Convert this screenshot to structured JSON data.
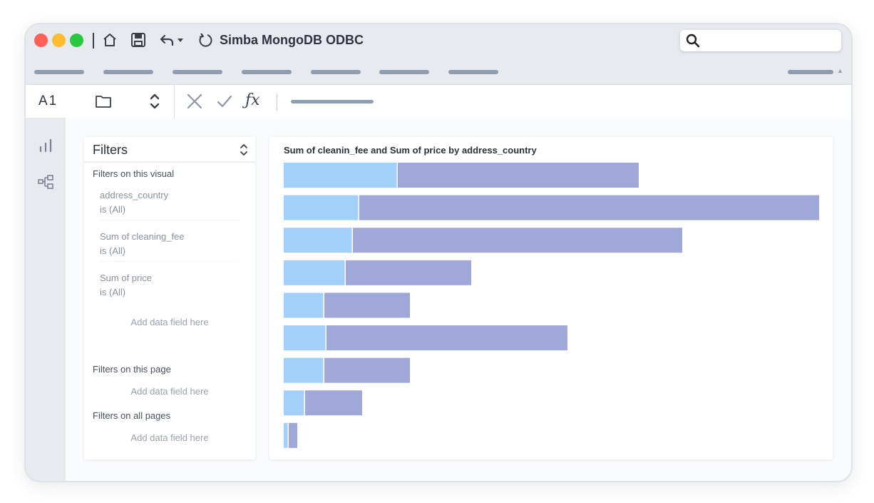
{
  "window": {
    "title": "Simba MongoDB ODBC"
  },
  "toolbar": {
    "icons": [
      "home-icon",
      "save-icon",
      "undo-icon",
      "dropdown-icon",
      "refresh-icon",
      "search-icon"
    ],
    "search_placeholder": ""
  },
  "formula_bar": {
    "cell_ref": "A1",
    "fx_label": "ƒx"
  },
  "sidenav": {
    "icons": [
      "chart-icon",
      "diagram-icon"
    ]
  },
  "filters": {
    "title": "Filters",
    "on_visual_label": "Filters on this visual",
    "items": [
      {
        "name": "address_country",
        "value": "is (All)"
      },
      {
        "name": "Sum of cleaning_fee",
        "value": "is (All)"
      },
      {
        "name": "Sum of price",
        "value": "is (All)"
      }
    ],
    "add_field_label": "Add data field here",
    "on_page_label": "Filters on this page",
    "on_all_pages_label": "Filters on all pages"
  },
  "colors": {
    "series1": "#a3d0fb",
    "series2": "#a0a8d9",
    "accent": "#8f9db3"
  },
  "chart_data": {
    "type": "bar",
    "orientation": "horizontal",
    "stacked": true,
    "title": "Sum of cleanin_fee and Sum of price by address_country",
    "categories": [
      "",
      "",
      "",
      "",
      "",
      "",
      "",
      "",
      ""
    ],
    "series": [
      {
        "values": [
          160,
          106,
          97,
          87,
          57,
          60,
          57,
          30,
          7
        ]
      },
      {
        "values": [
          338,
          645,
          462,
          176,
          120,
          338,
          120,
          80,
          12
        ]
      }
    ],
    "xlim": [
      0,
      760
    ],
    "grid": false,
    "legend": "none"
  }
}
